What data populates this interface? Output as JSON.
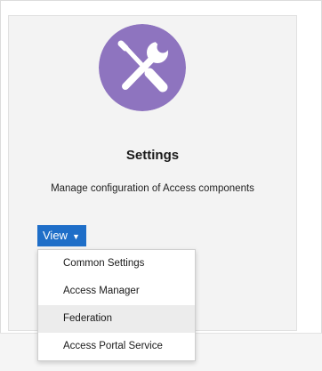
{
  "tile": {
    "icon": "wrench-screwdriver-icon",
    "icon_color": "#8e74bf",
    "title": "Settings",
    "description": "Manage configuration of Access components"
  },
  "view_button": {
    "label": "View",
    "color": "#1e6ec8"
  },
  "menu": {
    "items": [
      {
        "label": "Common Settings",
        "highlighted": false
      },
      {
        "label": "Access Manager",
        "highlighted": false
      },
      {
        "label": "Federation",
        "highlighted": true
      },
      {
        "label": "Access Portal Service",
        "highlighted": false
      }
    ]
  }
}
